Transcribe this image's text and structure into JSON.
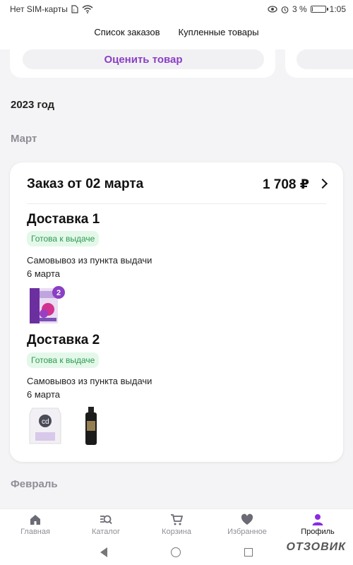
{
  "status_bar": {
    "carrier": "Нет SIM-карты",
    "battery_percent": "3 %",
    "battery_level": 0.03,
    "time": "1:05"
  },
  "tabs": [
    {
      "label": "Список заказов",
      "active": true
    },
    {
      "label": "Купленные товары",
      "active": false
    }
  ],
  "previous_card": {
    "rate_button": "Оценить товар"
  },
  "year_header": "2023 год",
  "months": {
    "march": "Март",
    "february": "Февраль"
  },
  "order": {
    "title": "Заказ от 02 марта",
    "total": "1 708 ₽",
    "deliveries": [
      {
        "title": "Доставка 1",
        "status": "Готова к выдаче",
        "method": "Самовывоз из пункта выдачи",
        "date": "6 марта",
        "products": [
          {
            "name": "purple-box-product",
            "badge": "2"
          }
        ]
      },
      {
        "title": "Доставка 2",
        "status": "Готова к выдаче",
        "method": "Самовывоз из пункта выдачи",
        "date": "6 марта",
        "products": [
          {
            "name": "white-pouch-product"
          },
          {
            "name": "dark-bottle-product"
          }
        ]
      }
    ]
  },
  "bottom_nav": [
    {
      "label": "Главная",
      "icon": "home-icon",
      "active": false
    },
    {
      "label": "Каталог",
      "icon": "catalog-search-icon",
      "active": false
    },
    {
      "label": "Корзина",
      "icon": "cart-icon",
      "active": false
    },
    {
      "label": "Избранное",
      "icon": "heart-icon",
      "active": false
    },
    {
      "label": "Профиль",
      "icon": "profile-icon",
      "active": true
    }
  ],
  "watermark": "ОТЗОВИК",
  "colors": {
    "accent": "#8a2be2",
    "status_green": "#2c9a4e",
    "badge_bg": "#e4f8ea",
    "muted": "#8e8e96"
  }
}
